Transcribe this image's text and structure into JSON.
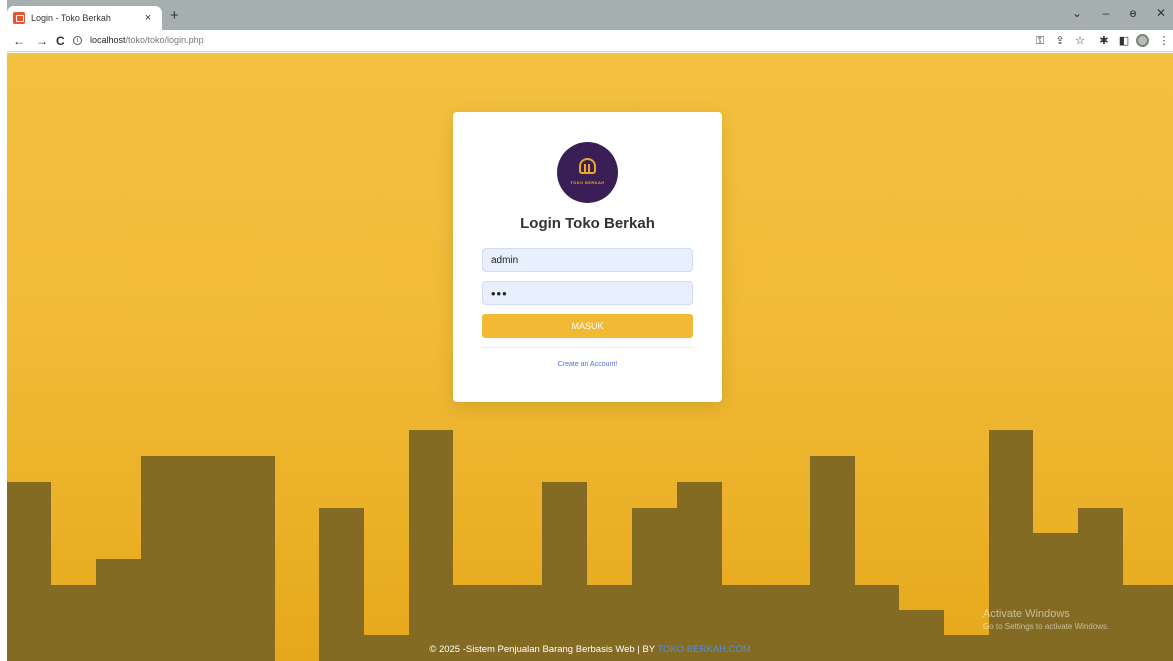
{
  "browser": {
    "tab_title": "Login - Toko Berkah",
    "tab_close": "×",
    "new_tab": "+",
    "window_controls": {
      "tabsearch": "⌄",
      "minimize": "–",
      "maximize": "ɵ",
      "close": "✕"
    },
    "nav": {
      "back": "←",
      "forward": "→",
      "reload": "C"
    },
    "url_host": "localhost",
    "url_path": "/toko/toko/login.php",
    "toolbar_icons": {
      "key": "⚿",
      "share": "⇪",
      "star": "☆",
      "extensions": "✱",
      "sidebar": "◧",
      "menu": "⋮"
    }
  },
  "login": {
    "logo_text": "TOKO BERKAH",
    "title": "Login Toko Berkah",
    "username_value": "admin",
    "password_mask": "•••",
    "submit_label": "MASUK",
    "create_account": "Create an Account!"
  },
  "footer": {
    "text": "© 2025 -Sistem Penjualan Barang Berbasis Web | BY ",
    "brand": "TOKO BERKAH.COM"
  },
  "watermark": {
    "line1": "Activate Windows",
    "line2": "Go to Settings to activate Windows."
  },
  "colors": {
    "accent": "#f2b935",
    "skyline": "#836b23",
    "logo_bg": "#3a1f57",
    "link": "#4e73df"
  }
}
